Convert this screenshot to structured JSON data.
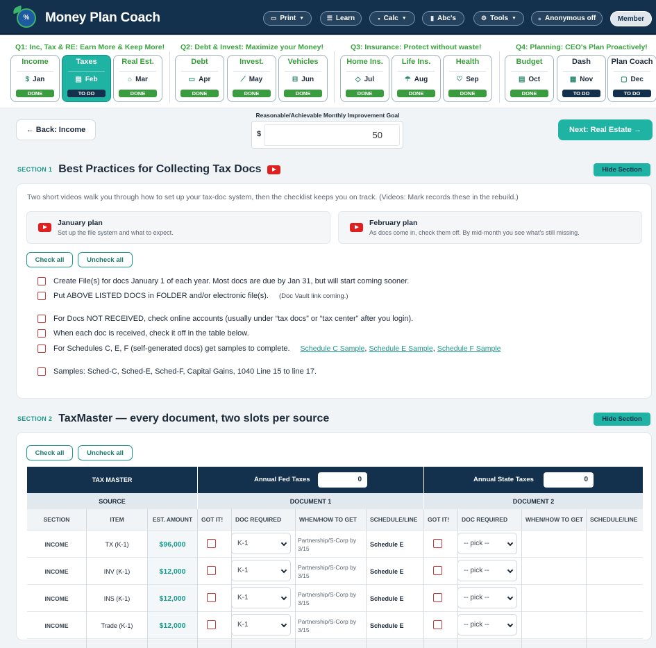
{
  "app": {
    "title": "Money Plan Coach",
    "logo_text": "%"
  },
  "topnav": {
    "print": "Print",
    "learn": "Learn",
    "calc": "Calc",
    "abcs": "Abc's",
    "tools": "Tools",
    "anonymous": "Anonymous off",
    "member": "Member"
  },
  "quarters": [
    {
      "label": "Q1: Inc, Tax & RE: Earn More & Keep More!"
    },
    {
      "label": "Q2: Debt & Invest: Maximize your Money!"
    },
    {
      "label": "Q3: Insurance: Protect without waste!"
    },
    {
      "label": "Q4: Planning: CEO's Plan Proactively!"
    }
  ],
  "months": [
    {
      "title": "Income",
      "month": "Jan",
      "icon": "dollar-icon",
      "glyph": "$",
      "status": "DONE"
    },
    {
      "title": "Taxes",
      "month": "Feb",
      "icon": "document-icon",
      "glyph": "▤",
      "status": "TO DO"
    },
    {
      "title": "Real Est.",
      "month": "Mar",
      "icon": "home-icon",
      "glyph": "⌂",
      "status": "DONE"
    },
    {
      "title": "Debt",
      "month": "Apr",
      "icon": "credit-card-icon",
      "glyph": "▭",
      "status": "DONE"
    },
    {
      "title": "Invest.",
      "month": "May",
      "icon": "chart-line-icon",
      "glyph": "⟋",
      "status": "DONE"
    },
    {
      "title": "Vehicles",
      "month": "Jun",
      "icon": "car-icon",
      "glyph": "⊟",
      "status": "DONE"
    },
    {
      "title": "Home Ins.",
      "month": "Jul",
      "icon": "shield-icon",
      "glyph": "◇",
      "status": "DONE"
    },
    {
      "title": "Life Ins.",
      "month": "Aug",
      "icon": "umbrella-icon",
      "glyph": "☂",
      "status": "DONE"
    },
    {
      "title": "Health",
      "month": "Sep",
      "icon": "heart-icon",
      "glyph": "♡",
      "status": "DONE"
    },
    {
      "title": "Budget",
      "month": "Oct",
      "icon": "receipt-icon",
      "glyph": "▤",
      "status": "DONE"
    },
    {
      "title": "Dash",
      "month": "Nov",
      "icon": "grid-icon",
      "glyph": "▦",
      "status": "TO DO"
    },
    {
      "title": "Plan Coach",
      "month": "Dec",
      "icon": "chat-icon",
      "glyph": "▢",
      "status": "TO DO"
    }
  ],
  "actions": {
    "back": "← Back: Income",
    "next": "Next: Real Estate →",
    "goal_label": "Reasonable/Achievable Monthly Improvement Goal",
    "goal_currency": "$",
    "goal_value": "50"
  },
  "section1": {
    "num": "SECTION 1",
    "title": "Best Practices for Collecting Tax Docs",
    "hide": "Hide Section",
    "intro": "Two short videos walk you through how to set up your tax-doc system, then the checklist keeps you on track. (Videos: Mark records these in the rebuild.)",
    "videos": [
      {
        "title": "January plan",
        "desc": "Set up the file system and what to expect."
      },
      {
        "title": "February plan",
        "desc": "As docs come in, check them off. By mid-month you see what's still missing."
      }
    ],
    "check_all": "Check all",
    "uncheck_all": "Uncheck all",
    "items": [
      {
        "text": "Create File(s) for docs January 1 of each year. Most docs are due by Jan 31, but will start coming sooner."
      },
      {
        "text": "Put ABOVE LISTED DOCS in FOLDER and/or electronic file(s).",
        "note": "(Doc Vault link coming.)"
      },
      {
        "text": "For Docs NOT RECEIVED, check online accounts (usually under “tax docs” or “tax center” after you login)."
      },
      {
        "text": "When each doc is received, check it off in the table below."
      },
      {
        "text": "For Schedules C, E, F (self-generated docs) get samples to complete.",
        "links": [
          "Schedule C Sample",
          "Schedule E Sample",
          "Schedule F Sample"
        ]
      },
      {
        "text": "Samples: Sched-C, Sched-E, Sched-F, Capital Gains, 1040 Line 15 to line 17."
      }
    ]
  },
  "section2": {
    "num": "SECTION 2",
    "title": "TaxMaster — every document, two slots per source",
    "hide": "Hide Section",
    "check_all": "Check all",
    "uncheck_all": "Uncheck all",
    "table": {
      "title": "TAX MASTER",
      "fed_label": "Annual Fed Taxes",
      "fed_value": "0",
      "state_label": "Annual State Taxes",
      "state_value": "0",
      "group_source": "SOURCE",
      "group_doc1": "DOCUMENT 1",
      "group_doc2": "DOCUMENT 2",
      "cols": [
        "SECTION",
        "ITEM",
        "EST. AMOUNT",
        "GOT IT!",
        "DOC REQUIRED",
        "WHEN/HOW TO GET",
        "SCHEDULE/LINE",
        "GOT IT!",
        "DOC REQUIRED",
        "WHEN/HOW TO GET",
        "SCHEDULE/LINE"
      ],
      "rows": [
        {
          "section": "INCOME",
          "item": "TX (K-1)",
          "amount": "$96,000",
          "doc1": "K-1",
          "when1": "Partnership/S-Corp by 3/15",
          "sched1": "Schedule E",
          "doc2": "-- pick --"
        },
        {
          "section": "INCOME",
          "item": "INV (K-1)",
          "amount": "$12,000",
          "doc1": "K-1",
          "when1": "Partnership/S-Corp by 3/15",
          "sched1": "Schedule E",
          "doc2": "-- pick --"
        },
        {
          "section": "INCOME",
          "item": "INS (K-1)",
          "amount": "$12,000",
          "doc1": "K-1",
          "when1": "Partnership/S-Corp by 3/15",
          "sched1": "Schedule E",
          "doc2": "-- pick --"
        },
        {
          "section": "INCOME",
          "item": "Trade (K-1)",
          "amount": "$12,000",
          "doc1": "K-1",
          "when1": "Partnership/S-Corp by 3/15",
          "sched1": "Schedule E",
          "doc2": "-- pick --"
        }
      ]
    }
  }
}
